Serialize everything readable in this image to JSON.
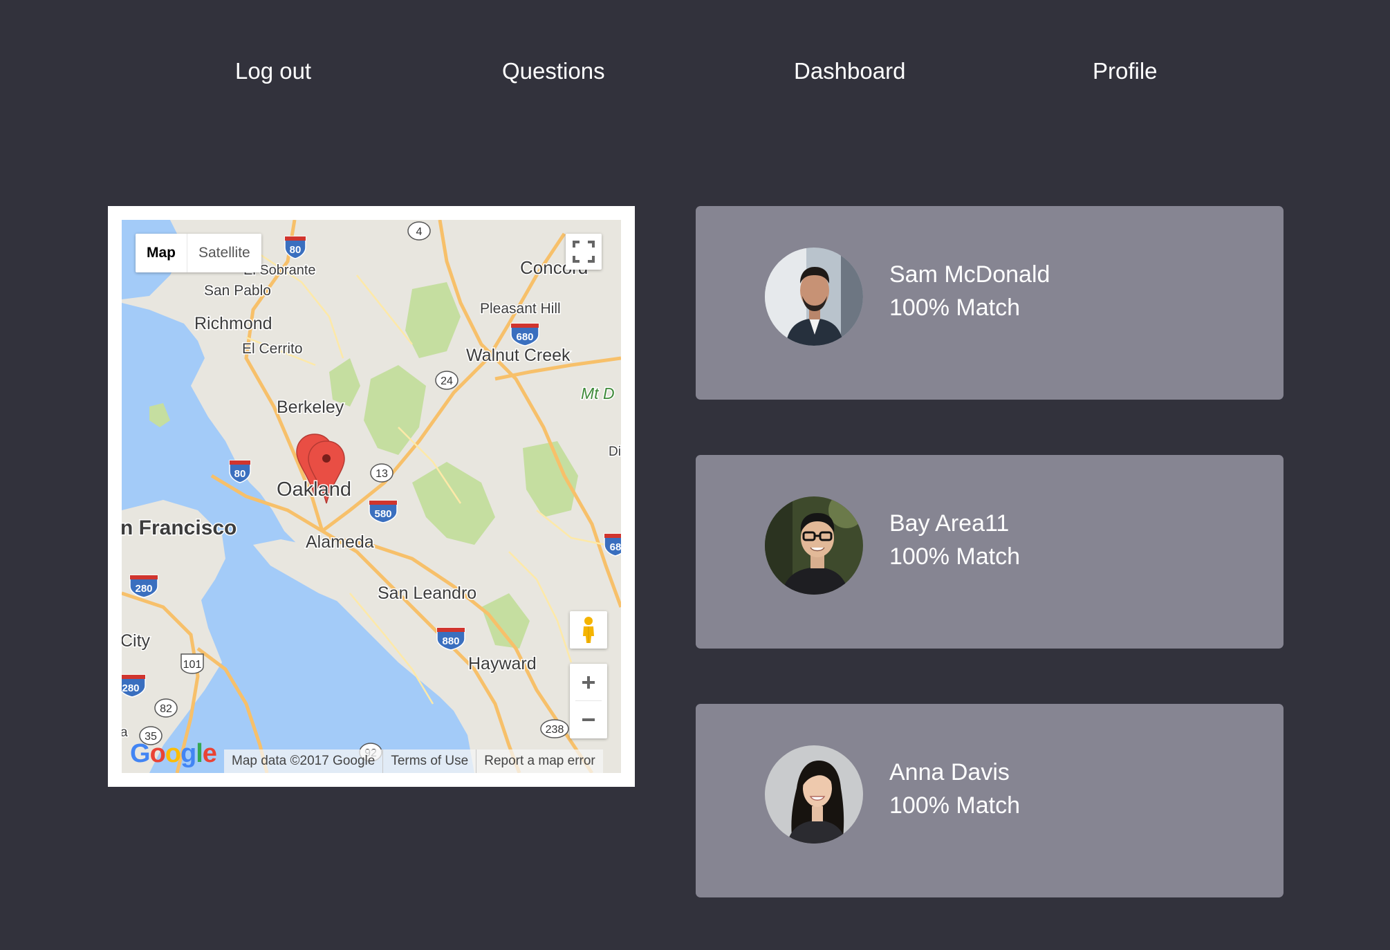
{
  "nav": {
    "logout": "Log out",
    "questions": "Questions",
    "dashboard": "Dashboard",
    "profile": "Profile"
  },
  "map": {
    "type_map": "Map",
    "type_satellite": "Satellite",
    "labels": {
      "el_sobrante": "El Sobrante",
      "san_pablo": "San Pablo",
      "richmond": "Richmond",
      "el_cerrito": "El Cerrito",
      "concord": "Concord",
      "pleasant_hill": "Pleasant Hill",
      "walnut_creek": "Walnut Creek",
      "mt_diablo": "Mt D",
      "berkeley": "Berkeley",
      "oakland": "Oakland",
      "san_francisco": "n Francisco",
      "alameda": "Alameda",
      "san_leandro": "San Leandro",
      "daly_city": "City",
      "hayward": "Hayward",
      "di": "Di",
      "a": "a"
    },
    "shields": {
      "i80_top": "80",
      "r4": "4",
      "i680": "680",
      "r24": "24",
      "i80_left": "80",
      "r13": "13",
      "i580": "580",
      "i280": "280",
      "i880": "880",
      "us101": "101",
      "i280_bottom": "280",
      "r82": "82",
      "r35": "35",
      "r92": "92",
      "r238": "238",
      "i68": "68"
    },
    "google": {
      "g1": "G",
      "o1": "o",
      "o2": "o",
      "g2": "g",
      "l": "l",
      "e": "e"
    },
    "footer": {
      "data": "Map data ©2017 Google",
      "terms": "Terms of Use",
      "report": "Report a map error"
    },
    "colors": {
      "water": "#a3cbf8",
      "land": "#e8e6df",
      "park": "#c5dea0",
      "highway": "#f7c06a",
      "road": "#fde9a8",
      "marker": "#e94e44"
    }
  },
  "cards": [
    {
      "name": "Sam McDonald",
      "match": "100% Match"
    },
    {
      "name": "Bay Area11",
      "match": "100% Match"
    },
    {
      "name": "Anna Davis",
      "match": "100% Match"
    }
  ],
  "colors": {
    "background": "#32323c",
    "card": "#868592",
    "text": "#ffffff"
  }
}
